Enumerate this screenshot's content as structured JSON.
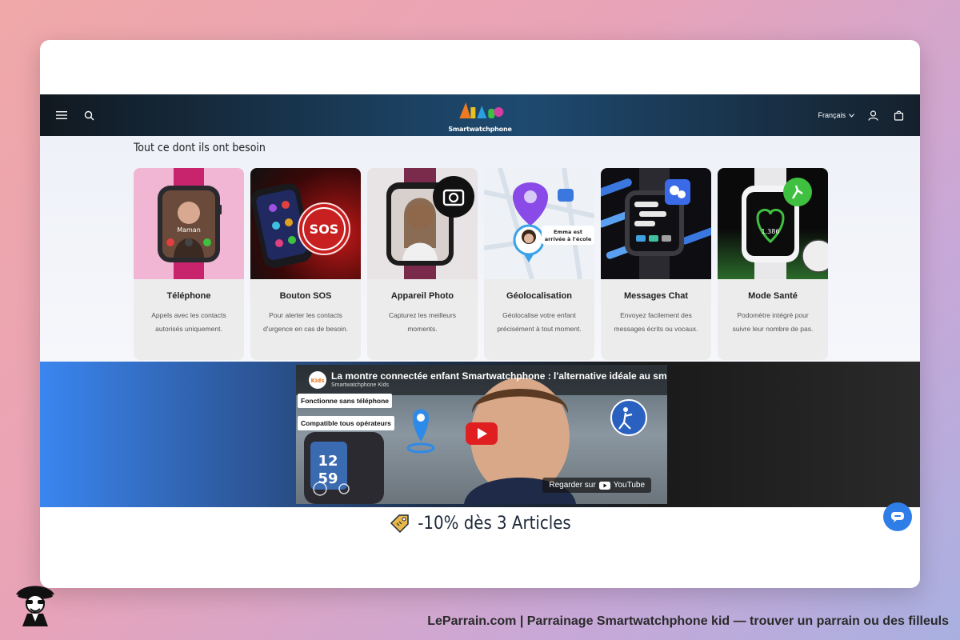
{
  "header": {
    "logo_text": "Smartwatchphone",
    "language": "Français",
    "menu_icon": "menu-icon",
    "search_icon": "search-icon",
    "account_icon": "account-icon",
    "cart_icon": "cart-icon"
  },
  "features": {
    "title": "Tout ce dont ils ont besoin",
    "items": [
      {
        "title": "Téléphone",
        "desc": "Appels avec les contacts autorisés uniquement.",
        "img_label": "Maman",
        "icon": "phone-watch"
      },
      {
        "title": "Bouton SOS",
        "desc": "Pour alerter les contacts d'urgence en cas de besoin.",
        "img_label": "SOS",
        "icon": "sos-watch"
      },
      {
        "title": "Appareil Photo",
        "desc": "Capturez les meilleurs moments.",
        "img_label": "",
        "icon": "camera-watch"
      },
      {
        "title": "Géolocalisation",
        "desc": "Géolocalise votre enfant précisément à tout moment.",
        "img_label": "Emma est arrivée à l'école",
        "icon": "map-pin"
      },
      {
        "title": "Messages Chat",
        "desc": "Envoyez facilement des messages écrits ou vocaux.",
        "img_label": "",
        "icon": "chat-watch"
      },
      {
        "title": "Mode Santé",
        "desc": "Podomètre intégré pour suivre leur nombre de pas.",
        "img_label": "1,386",
        "icon": "health-watch"
      }
    ]
  },
  "video": {
    "title": "La montre connectée enfant Smartwatchphone : l'alternative idéale au smart",
    "channel": "Smartwatchphone Kids",
    "badge1": "Fonctionne sans téléphone",
    "badge2": "Compatible tous opérateurs",
    "watch_label": "Regarder sur",
    "youtube": "YouTube"
  },
  "promo": {
    "text": "-10% dès 3 Articles"
  },
  "caption": "LeParrain.com | Parrainage Smartwatchphone kid — trouver un parrain ou des filleuls",
  "colors": {
    "accent": "#2f7ee8",
    "header_dark": "#1b3f5e",
    "sos_red": "#d83030",
    "strap_pink": "#c8246e"
  }
}
